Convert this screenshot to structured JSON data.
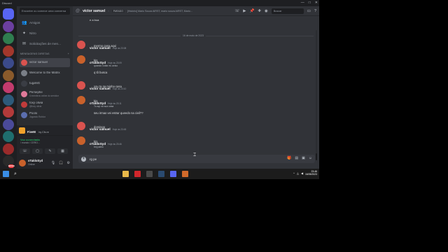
{
  "window": {
    "title": "Discord",
    "controls": [
      "—",
      "□",
      "✕"
    ]
  },
  "servers": {
    "items": [
      {
        "label": "home",
        "color": "#5865f2"
      },
      {
        "label": "server-1",
        "color": "#6b3fa0"
      },
      {
        "label": "server-2",
        "color": "#2f7d4f"
      },
      {
        "label": "server-3",
        "color": "#a3372c"
      },
      {
        "label": "server-4",
        "color": "#3b4a8a"
      },
      {
        "label": "server-5",
        "color": "#8a5a2b"
      },
      {
        "label": "server-6",
        "color": "#c23b6d"
      },
      {
        "label": "server-7",
        "color": "#2d5a7a"
      },
      {
        "label": "server-8",
        "color": "#b33a3a"
      },
      {
        "label": "server-9",
        "color": "#4a4a9a"
      },
      {
        "label": "server-10",
        "color": "#1f6e6e"
      },
      {
        "label": "server-11",
        "color": "#9a2b2b"
      },
      {
        "label": "server-12",
        "color": "#2a2a2a"
      }
    ],
    "badge": "NOVO"
  },
  "sidebar": {
    "search_placeholder": "Encontre ou comece uma conversa",
    "nav": [
      {
        "label": "Amigos",
        "icon": "👥"
      },
      {
        "label": "Nitro",
        "icon": "✦"
      },
      {
        "label": "Solicitações de men...",
        "icon": "✉"
      }
    ],
    "dm_header": "MENSAGENS DIRETAS",
    "dm_add": "+",
    "dms": [
      {
        "name": "victor samuel",
        "sub": "",
        "color": "#d9534f",
        "active": true
      },
      {
        "name": "Welcome to the Matrix",
        "sub": "",
        "color": "#7a7f87",
        "active": false
      },
      {
        "name": "tugaNG",
        "sub": "",
        "color": "#3a3d44",
        "active": false
      },
      {
        "name": "Persephe",
        "sub": "4 membros online do servidor",
        "color": "#e07a9a",
        "active": false
      },
      {
        "name": "foxy olivia",
        "sub": "@foxy olivia",
        "color": "#c23b3b",
        "active": false
      },
      {
        "name": "Poolo",
        "sub": "Jogando Roblox",
        "color": "#5b6eae",
        "active": false
      }
    ]
  },
  "activity": {
    "name": "FiveM",
    "sub": "by Cfx.re"
  },
  "voice": {
    "status": "Voz conectada",
    "channel": "/ mundo / CERO...",
    "buttons": [
      "☏",
      "▢",
      "✎",
      "▦"
    ]
  },
  "user": {
    "name": "oTaldoSyd",
    "status": "Online",
    "color": "#c9612b"
  },
  "chat": {
    "recipient": "victor samuel",
    "tag": "PARADO",
    "status_text": "[Histório] Mario Souza AIRST, mario souza AIRST, Mario...",
    "search_placeholder": "Buscar",
    "top_line": "e a boa",
    "date_divider": "16 de maio de 2023",
    "messages": [
      {
        "author": "victor samuel",
        "time": "Hoje às 23:08",
        "color": "#d9534f",
        "lines": [
          {
            "text": "mermo casa aqui",
            "small": false
          }
        ]
      },
      {
        "author": "oTaldoSyd",
        "time": "Hoje às 23:09",
        "color": "#c9612b",
        "lines": [
          {
            "text": "blz",
            "small": false
          },
          {
            "text": "quando voltar eu aviso",
            "small": true
          },
          {
            "text": "q tô busca",
            "small": false
          }
        ]
      },
      {
        "author": "victor samuel",
        "time": "Hoje às 23:10",
        "color": "#d9534f",
        "lines": [
          {
            "text": "vou ta na minha casa",
            "small": false
          }
        ]
      },
      {
        "author": "oTaldoSyd",
        "time": "Hoje às 23:11",
        "color": "#c9612b",
        "lines": [
          {
            "text": "blz",
            "small": false
          },
          {
            "text": "To aqi na sua casa",
            "small": true
          },
          {
            "text": "seu irmao vei estrar queedo na civil??",
            "small": false
          }
        ]
      },
      {
        "author": "victor samuel",
        "time": "Hoje às 23:45",
        "color": "#d9534f",
        "lines": [
          {
            "text": "domingo",
            "small": false
          }
        ]
      },
      {
        "author": "oTaldoSyd",
        "time": "Hoje às 23:46",
        "color": "#c9612b",
        "lines": [
          {
            "text": "blz",
            "small": false
          },
          {
            "text": "tmj pablo",
            "small": true
          }
        ]
      }
    ],
    "composer_text": "rg pe"
  },
  "taskbar": {
    "apps": [
      {
        "name": "windows",
        "color": "#3a8ee6"
      },
      {
        "name": "search",
        "color": "#1c1c1c"
      },
      {
        "name": "file-explorer",
        "color": "#e8b84a"
      },
      {
        "name": "opera",
        "color": "#d0262b"
      },
      {
        "name": "app-3",
        "color": "#4a4a4a"
      },
      {
        "name": "steam",
        "color": "#2a4a70"
      },
      {
        "name": "discord",
        "color": "#5865f2"
      },
      {
        "name": "app-6",
        "color": "#d06a2b"
      }
    ],
    "clock_time": "23:46",
    "clock_date": "16/05/2023"
  }
}
